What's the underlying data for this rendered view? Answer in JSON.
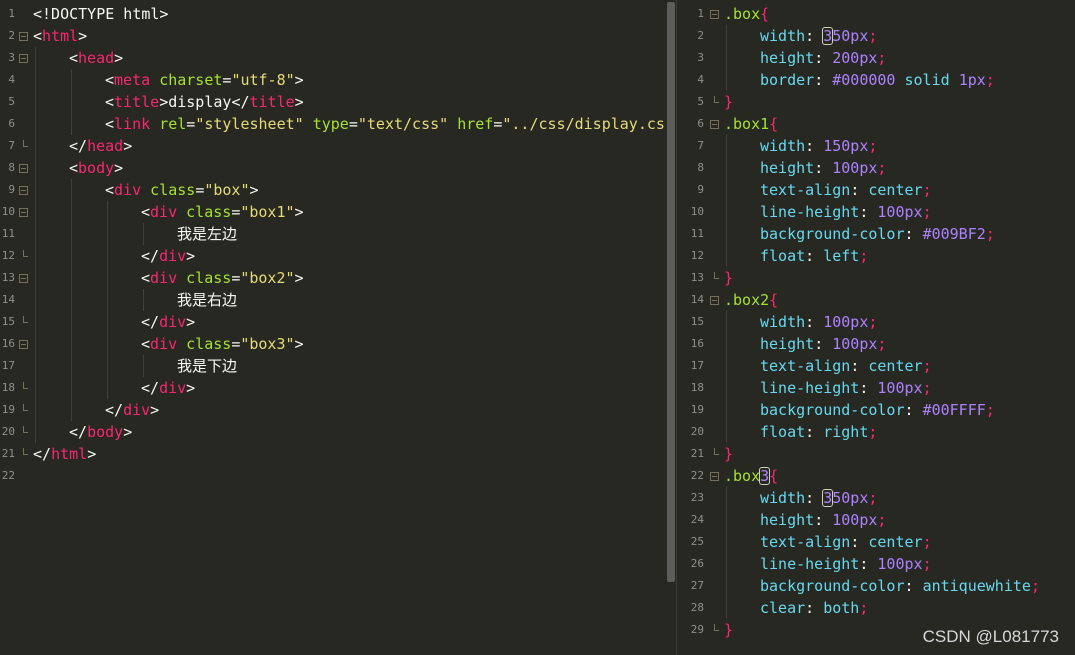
{
  "colors": {
    "background": "#272822",
    "tag": "#f92672",
    "attribute": "#a6e22e",
    "string": "#e6db74",
    "property": "#66d9ef",
    "number": "#ae81ff",
    "text": "#f8f8f2"
  },
  "watermark": "CSDN @L081773",
  "html_editor": {
    "lines": [
      {
        "n": "1",
        "fold": null,
        "indent": 0,
        "tokens": [
          [
            "punc",
            "<!DOCTYPE html>"
          ]
        ]
      },
      {
        "n": "2",
        "fold": "open",
        "indent": 0,
        "tokens": [
          [
            "punc",
            "<"
          ],
          [
            "tag",
            "html"
          ],
          [
            "punc",
            ">"
          ]
        ]
      },
      {
        "n": "3",
        "fold": "open",
        "indent": 1,
        "tokens": [
          [
            "punc",
            "<"
          ],
          [
            "tag",
            "head"
          ],
          [
            "punc",
            ">"
          ]
        ]
      },
      {
        "n": "4",
        "fold": null,
        "indent": 2,
        "tokens": [
          [
            "punc",
            "<"
          ],
          [
            "tag",
            "meta"
          ],
          [
            "punc",
            " "
          ],
          [
            "attr",
            "charset"
          ],
          [
            "punc",
            "="
          ],
          [
            "str",
            "\"utf-8\""
          ],
          [
            "punc",
            ">"
          ]
        ]
      },
      {
        "n": "5",
        "fold": null,
        "indent": 2,
        "tokens": [
          [
            "punc",
            "<"
          ],
          [
            "tag",
            "title"
          ],
          [
            "punc",
            ">"
          ],
          [
            "text",
            "display"
          ],
          [
            "punc",
            "</"
          ],
          [
            "tag",
            "title"
          ],
          [
            "punc",
            ">"
          ]
        ]
      },
      {
        "n": "6",
        "fold": null,
        "indent": 2,
        "tokens": [
          [
            "punc",
            "<"
          ],
          [
            "tag",
            "link"
          ],
          [
            "punc",
            " "
          ],
          [
            "attr",
            "rel"
          ],
          [
            "punc",
            "="
          ],
          [
            "str",
            "\"stylesheet\""
          ],
          [
            "punc",
            " "
          ],
          [
            "attr",
            "type"
          ],
          [
            "punc",
            "="
          ],
          [
            "str",
            "\"text/css\""
          ],
          [
            "punc",
            " "
          ],
          [
            "attr",
            "href"
          ],
          [
            "punc",
            "="
          ],
          [
            "str",
            "\"../css/display.css\""
          ]
        ]
      },
      {
        "n": "7",
        "fold": "end",
        "indent": 1,
        "tokens": [
          [
            "punc",
            "</"
          ],
          [
            "tag",
            "head"
          ],
          [
            "punc",
            ">"
          ]
        ]
      },
      {
        "n": "8",
        "fold": "open",
        "indent": 1,
        "tokens": [
          [
            "punc",
            "<"
          ],
          [
            "tag",
            "body"
          ],
          [
            "punc",
            ">"
          ]
        ]
      },
      {
        "n": "9",
        "fold": "open",
        "indent": 2,
        "tokens": [
          [
            "punc",
            "<"
          ],
          [
            "tag",
            "div"
          ],
          [
            "punc",
            " "
          ],
          [
            "attr",
            "class"
          ],
          [
            "punc",
            "="
          ],
          [
            "str",
            "\"box\""
          ],
          [
            "punc",
            ">"
          ]
        ]
      },
      {
        "n": "10",
        "fold": "open",
        "indent": 3,
        "tokens": [
          [
            "punc",
            "<"
          ],
          [
            "tag",
            "div"
          ],
          [
            "punc",
            " "
          ],
          [
            "attr",
            "class"
          ],
          [
            "punc",
            "="
          ],
          [
            "str",
            "\"box1\""
          ],
          [
            "punc",
            ">"
          ]
        ]
      },
      {
        "n": "11",
        "fold": null,
        "indent": 4,
        "tokens": [
          [
            "text",
            "我是左边"
          ]
        ]
      },
      {
        "n": "12",
        "fold": "end",
        "indent": 3,
        "tokens": [
          [
            "punc",
            "</"
          ],
          [
            "tag",
            "div"
          ],
          [
            "punc",
            ">"
          ]
        ]
      },
      {
        "n": "13",
        "fold": "open",
        "indent": 3,
        "tokens": [
          [
            "punc",
            "<"
          ],
          [
            "tag",
            "div"
          ],
          [
            "punc",
            " "
          ],
          [
            "attr",
            "class"
          ],
          [
            "punc",
            "="
          ],
          [
            "str",
            "\"box2\""
          ],
          [
            "punc",
            ">"
          ]
        ]
      },
      {
        "n": "14",
        "fold": null,
        "indent": 4,
        "tokens": [
          [
            "text",
            "我是右边"
          ]
        ]
      },
      {
        "n": "15",
        "fold": "end",
        "indent": 3,
        "tokens": [
          [
            "punc",
            "</"
          ],
          [
            "tag",
            "div"
          ],
          [
            "punc",
            ">"
          ]
        ]
      },
      {
        "n": "16",
        "fold": "open",
        "indent": 3,
        "tokens": [
          [
            "punc",
            "<"
          ],
          [
            "tag",
            "div"
          ],
          [
            "punc",
            " "
          ],
          [
            "attr",
            "class"
          ],
          [
            "punc",
            "="
          ],
          [
            "str",
            "\"box3\""
          ],
          [
            "punc",
            ">"
          ]
        ]
      },
      {
        "n": "17",
        "fold": null,
        "indent": 4,
        "tokens": [
          [
            "text",
            "我是下边"
          ]
        ]
      },
      {
        "n": "18",
        "fold": "end",
        "indent": 3,
        "tokens": [
          [
            "punc",
            "</"
          ],
          [
            "tag",
            "div"
          ],
          [
            "punc",
            ">"
          ]
        ]
      },
      {
        "n": "19",
        "fold": "end",
        "indent": 2,
        "tokens": [
          [
            "punc",
            "</"
          ],
          [
            "tag",
            "div"
          ],
          [
            "punc",
            ">"
          ]
        ]
      },
      {
        "n": "20",
        "fold": "end",
        "indent": 1,
        "tokens": [
          [
            "punc",
            "</"
          ],
          [
            "tag",
            "body"
          ],
          [
            "punc",
            ">"
          ]
        ]
      },
      {
        "n": "21",
        "fold": "end",
        "indent": 0,
        "tokens": [
          [
            "punc",
            "</"
          ],
          [
            "tag",
            "html"
          ],
          [
            "punc",
            ">"
          ]
        ]
      },
      {
        "n": "22",
        "fold": null,
        "indent": 0,
        "tokens": []
      }
    ]
  },
  "css_editor": {
    "lines": [
      {
        "n": "1",
        "fold": "open",
        "indent": 0,
        "tokens": [
          [
            "sel",
            ".box"
          ],
          [
            "brace",
            "{"
          ]
        ]
      },
      {
        "n": "2",
        "fold": null,
        "indent": 1,
        "tokens": [
          [
            "prop",
            "width"
          ],
          [
            "punc",
            ": "
          ],
          [
            "caret",
            "3"
          ],
          [
            "val",
            "50px"
          ],
          [
            "semi",
            ";"
          ]
        ]
      },
      {
        "n": "3",
        "fold": null,
        "indent": 1,
        "tokens": [
          [
            "prop",
            "height"
          ],
          [
            "punc",
            ": "
          ],
          [
            "val",
            "200px"
          ],
          [
            "semi",
            ";"
          ]
        ]
      },
      {
        "n": "4",
        "fold": null,
        "indent": 1,
        "tokens": [
          [
            "prop",
            "border"
          ],
          [
            "punc",
            ": "
          ],
          [
            "val",
            "#000000"
          ],
          [
            "punc",
            " "
          ],
          [
            "kw",
            "solid"
          ],
          [
            "punc",
            " "
          ],
          [
            "val",
            "1px"
          ],
          [
            "semi",
            ";"
          ]
        ]
      },
      {
        "n": "5",
        "fold": "end",
        "indent": 0,
        "tokens": [
          [
            "brace",
            "}"
          ]
        ]
      },
      {
        "n": "6",
        "fold": "open",
        "indent": 0,
        "tokens": [
          [
            "sel",
            ".box1"
          ],
          [
            "brace",
            "{"
          ]
        ]
      },
      {
        "n": "7",
        "fold": null,
        "indent": 1,
        "tokens": [
          [
            "prop",
            "width"
          ],
          [
            "punc",
            ": "
          ],
          [
            "val",
            "150px"
          ],
          [
            "semi",
            ";"
          ]
        ]
      },
      {
        "n": "8",
        "fold": null,
        "indent": 1,
        "tokens": [
          [
            "prop",
            "height"
          ],
          [
            "punc",
            ": "
          ],
          [
            "val",
            "100px"
          ],
          [
            "semi",
            ";"
          ]
        ]
      },
      {
        "n": "9",
        "fold": null,
        "indent": 1,
        "tokens": [
          [
            "prop",
            "text-align"
          ],
          [
            "punc",
            ": "
          ],
          [
            "kw",
            "center"
          ],
          [
            "semi",
            ";"
          ]
        ]
      },
      {
        "n": "10",
        "fold": null,
        "indent": 1,
        "tokens": [
          [
            "prop",
            "line-height"
          ],
          [
            "punc",
            ": "
          ],
          [
            "val",
            "100px"
          ],
          [
            "semi",
            ";"
          ]
        ]
      },
      {
        "n": "11",
        "fold": null,
        "indent": 1,
        "tokens": [
          [
            "prop",
            "background-color"
          ],
          [
            "punc",
            ": "
          ],
          [
            "val",
            "#009BF2"
          ],
          [
            "semi",
            ";"
          ]
        ]
      },
      {
        "n": "12",
        "fold": null,
        "indent": 1,
        "tokens": [
          [
            "prop",
            "float"
          ],
          [
            "punc",
            ": "
          ],
          [
            "kw",
            "left"
          ],
          [
            "semi",
            ";"
          ]
        ]
      },
      {
        "n": "13",
        "fold": "end",
        "indent": 0,
        "tokens": [
          [
            "brace",
            "}"
          ]
        ]
      },
      {
        "n": "14",
        "fold": "open",
        "indent": 0,
        "tokens": [
          [
            "sel",
            ".box2"
          ],
          [
            "brace",
            "{"
          ]
        ]
      },
      {
        "n": "15",
        "fold": null,
        "indent": 1,
        "tokens": [
          [
            "prop",
            "width"
          ],
          [
            "punc",
            ": "
          ],
          [
            "val",
            "100px"
          ],
          [
            "semi",
            ";"
          ]
        ]
      },
      {
        "n": "16",
        "fold": null,
        "indent": 1,
        "tokens": [
          [
            "prop",
            "height"
          ],
          [
            "punc",
            ": "
          ],
          [
            "val",
            "100px"
          ],
          [
            "semi",
            ";"
          ]
        ]
      },
      {
        "n": "17",
        "fold": null,
        "indent": 1,
        "tokens": [
          [
            "prop",
            "text-align"
          ],
          [
            "punc",
            ": "
          ],
          [
            "kw",
            "center"
          ],
          [
            "semi",
            ";"
          ]
        ]
      },
      {
        "n": "18",
        "fold": null,
        "indent": 1,
        "tokens": [
          [
            "prop",
            "line-height"
          ],
          [
            "punc",
            ": "
          ],
          [
            "val",
            "100px"
          ],
          [
            "semi",
            ";"
          ]
        ]
      },
      {
        "n": "19",
        "fold": null,
        "indent": 1,
        "tokens": [
          [
            "prop",
            "background-color"
          ],
          [
            "punc",
            ": "
          ],
          [
            "val",
            "#00FFFF"
          ],
          [
            "semi",
            ";"
          ]
        ]
      },
      {
        "n": "20",
        "fold": null,
        "indent": 1,
        "tokens": [
          [
            "prop",
            "float"
          ],
          [
            "punc",
            ": "
          ],
          [
            "kw",
            "right"
          ],
          [
            "semi",
            ";"
          ]
        ]
      },
      {
        "n": "21",
        "fold": "end",
        "indent": 0,
        "tokens": [
          [
            "brace",
            "}"
          ]
        ]
      },
      {
        "n": "22",
        "fold": "open",
        "indent": 0,
        "tokens": [
          [
            "sel",
            ".box"
          ],
          [
            "caret",
            "3"
          ],
          [
            "brace",
            "{"
          ]
        ]
      },
      {
        "n": "23",
        "fold": null,
        "indent": 1,
        "tokens": [
          [
            "prop",
            "width"
          ],
          [
            "punc",
            ": "
          ],
          [
            "caret",
            "3"
          ],
          [
            "val",
            "50px"
          ],
          [
            "semi",
            ";"
          ]
        ]
      },
      {
        "n": "24",
        "fold": null,
        "indent": 1,
        "tokens": [
          [
            "prop",
            "height"
          ],
          [
            "punc",
            ": "
          ],
          [
            "val",
            "100px"
          ],
          [
            "semi",
            ";"
          ]
        ]
      },
      {
        "n": "25",
        "fold": null,
        "indent": 1,
        "tokens": [
          [
            "prop",
            "text-align"
          ],
          [
            "punc",
            ": "
          ],
          [
            "kw",
            "center"
          ],
          [
            "semi",
            ";"
          ]
        ]
      },
      {
        "n": "26",
        "fold": null,
        "indent": 1,
        "tokens": [
          [
            "prop",
            "line-height"
          ],
          [
            "punc",
            ": "
          ],
          [
            "val",
            "100px"
          ],
          [
            "semi",
            ";"
          ]
        ]
      },
      {
        "n": "27",
        "fold": null,
        "indent": 1,
        "tokens": [
          [
            "prop",
            "background-color"
          ],
          [
            "punc",
            ": "
          ],
          [
            "kw",
            "antiquewhite"
          ],
          [
            "semi",
            ";"
          ]
        ]
      },
      {
        "n": "28",
        "fold": null,
        "indent": 1,
        "tokens": [
          [
            "prop",
            "clear"
          ],
          [
            "punc",
            ": "
          ],
          [
            "kw",
            "both"
          ],
          [
            "semi",
            ";"
          ]
        ]
      },
      {
        "n": "29",
        "fold": "end",
        "indent": 0,
        "tokens": [
          [
            "brace",
            "}"
          ]
        ]
      }
    ]
  }
}
